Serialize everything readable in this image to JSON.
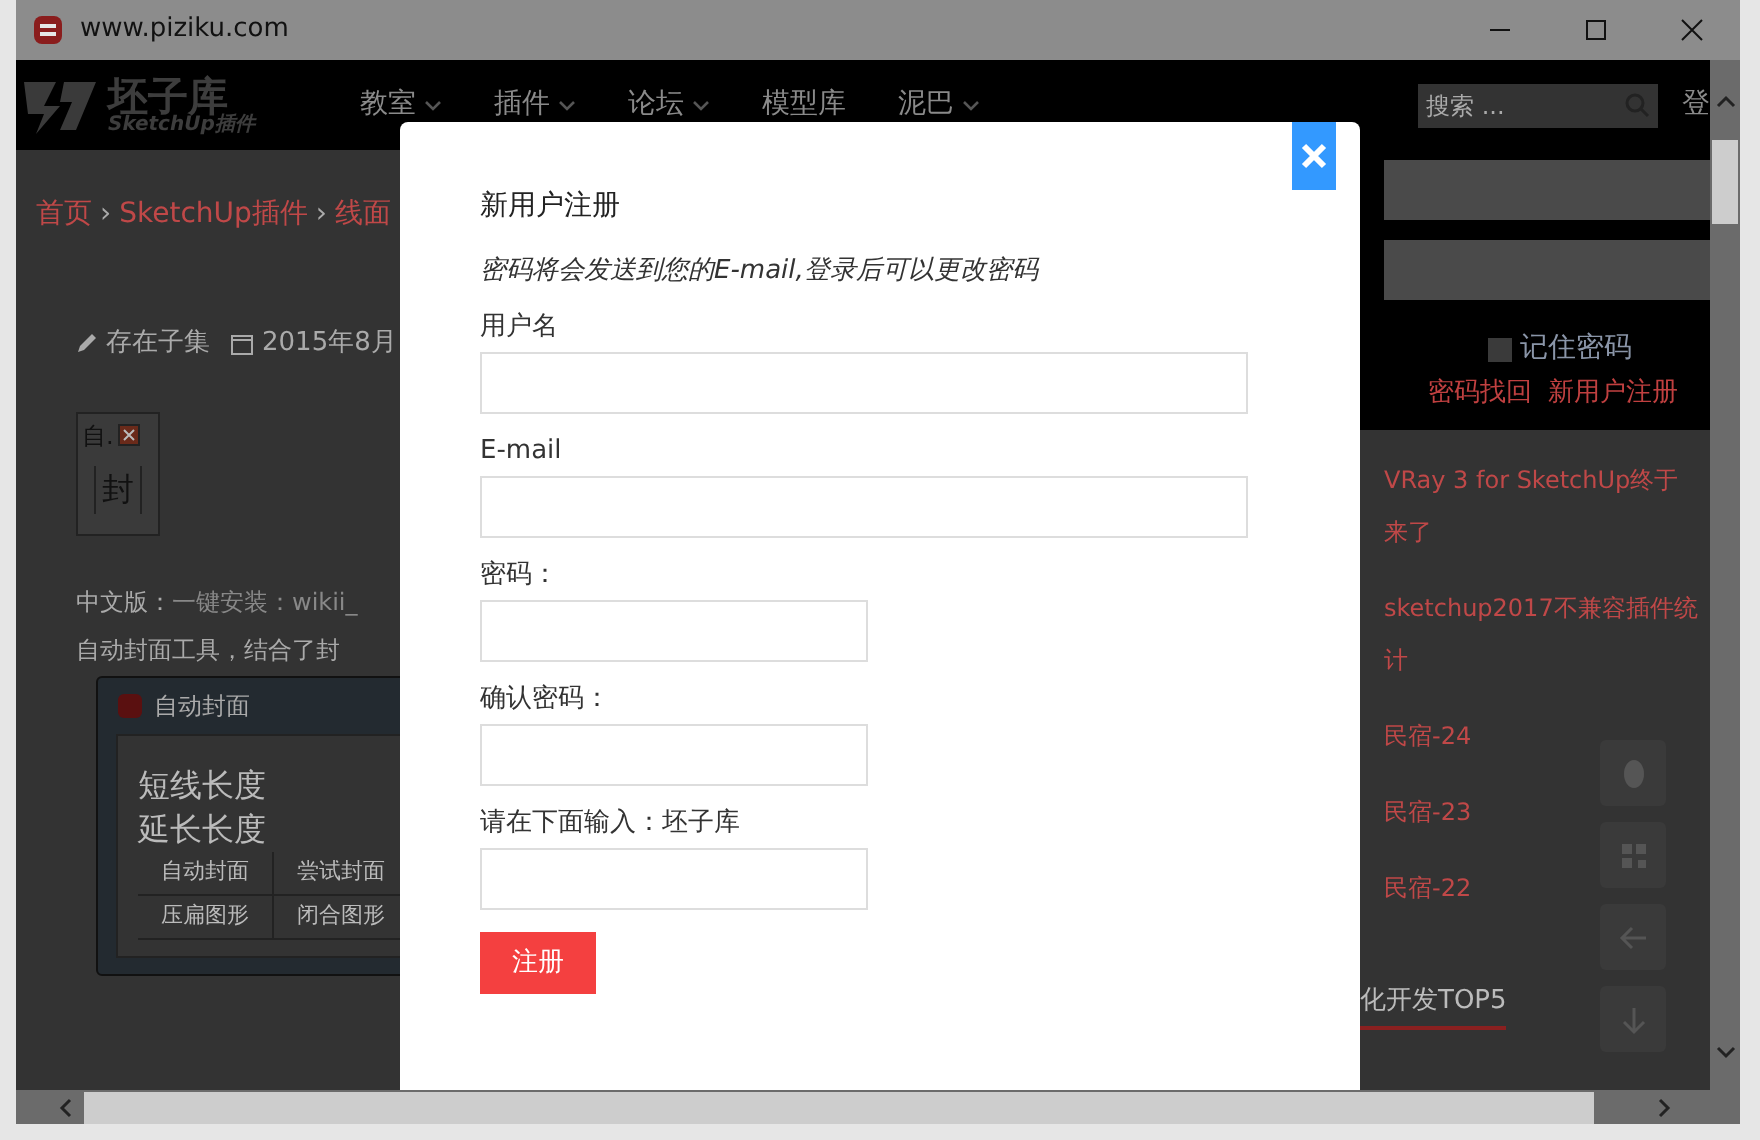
{
  "window": {
    "title": "www.piziku.com"
  },
  "nav": {
    "logo_title": "坯子库",
    "logo_subtitle": "SketchUp插件",
    "items": [
      {
        "label": "教室",
        "has_menu": true
      },
      {
        "label": "插件",
        "has_menu": true
      },
      {
        "label": "论坛",
        "has_menu": true
      },
      {
        "label": "模型库",
        "has_menu": false
      },
      {
        "label": "泥巴",
        "has_menu": true
      }
    ],
    "search_placeholder": "搜索 ...",
    "login": "登"
  },
  "breadcrumb": {
    "separator": "›",
    "items": [
      "首页",
      "SketchUp插件",
      "线面"
    ]
  },
  "meta": {
    "author": "存在子集",
    "date": "2015年8月"
  },
  "plugin_toolbar": {
    "title": "自.",
    "button": "封"
  },
  "paragraphs": [
    {
      "label": "中文版：",
      "link": "一键安装：wikii_"
    },
    {
      "label": "自动封面工具，结合了封"
    }
  ],
  "plugin_window": {
    "title": "自动封面",
    "labels": [
      "短线长度",
      "延长长度"
    ],
    "buttons": [
      "自动封面",
      "尝试封面",
      "压扁图形",
      "闭合图形"
    ]
  },
  "sidebar": {
    "remember": {
      "label": "记住密码",
      "checked": false
    },
    "links": [
      "密码找回",
      "新用户注册"
    ],
    "posts": [
      "VRay 3 for SketchUp终于来了",
      "sketchup2017不兼容插件统计",
      "民宿-24",
      "民宿-23",
      "民宿-22"
    ],
    "section_title": "化开发TOP5"
  },
  "modal": {
    "title": "新用户注册",
    "note": "密码将会发送到您的E-mail,登录后可以更改密码",
    "fields": [
      {
        "label": "用户名",
        "kind": "wide"
      },
      {
        "label": "E-mail",
        "kind": "wide"
      },
      {
        "label": "密码：",
        "kind": "short"
      },
      {
        "label": "确认密码：",
        "kind": "short"
      },
      {
        "label": "请在下面输入：坯子库",
        "kind": "short"
      }
    ],
    "submit": "注册"
  }
}
